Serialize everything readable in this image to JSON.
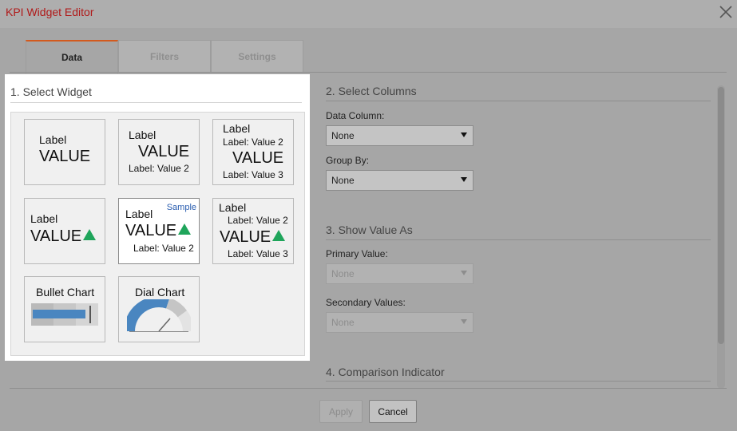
{
  "window": {
    "title": "KPI Widget Editor"
  },
  "tabs": [
    {
      "label": "Data",
      "active": true
    },
    {
      "label": "Filters",
      "active": false
    },
    {
      "label": "Settings",
      "active": false
    }
  ],
  "select_widget": {
    "title": "1. Select Widget",
    "widgets": {
      "w1": {
        "label": "Label",
        "value": "VALUE"
      },
      "w2": {
        "label": "Label",
        "value": "VALUE",
        "sub1": "Label: Value 2"
      },
      "w3": {
        "label": "Label",
        "value": "VALUE",
        "sub1": "Label: Value 2",
        "sub2": "Label: Value 3"
      },
      "w4": {
        "label": "Label",
        "value": "VALUE"
      },
      "w5": {
        "label": "Label",
        "value": "VALUE",
        "sub1": "Label: Value 2",
        "badge": "Sample",
        "selected": true
      },
      "w6": {
        "label": "Label",
        "value": "VALUE",
        "sub1": "Label: Value 2",
        "sub2": "Label: Value 3"
      },
      "w7": {
        "label": "Bullet Chart"
      },
      "w8": {
        "label": "Dial Chart"
      }
    }
  },
  "select_columns": {
    "title": "2. Select Columns",
    "data_column": {
      "label": "Data Column:",
      "value": "None"
    },
    "group_by": {
      "label": "Group By:",
      "value": "None"
    }
  },
  "show_value_as": {
    "title": "3. Show Value As",
    "primary": {
      "label": "Primary Value:",
      "value": "None",
      "disabled": true
    },
    "secondary": {
      "label": "Secondary Values:",
      "value": "None",
      "disabled": true
    }
  },
  "comparison": {
    "title": "4. Comparison Indicator"
  },
  "footer": {
    "apply_label": "Apply",
    "cancel_label": "Cancel"
  },
  "colors": {
    "title_red": "#b01a1a",
    "tab_accent": "#d35a1e",
    "indicator_green": "#1fa55b",
    "sample_blue": "#2a5db0",
    "chart_blue": "#4a86c0"
  },
  "icons": {
    "close": "close-icon",
    "dropdown": "caret-down-icon",
    "up_indicator": "triangle-up-icon"
  }
}
